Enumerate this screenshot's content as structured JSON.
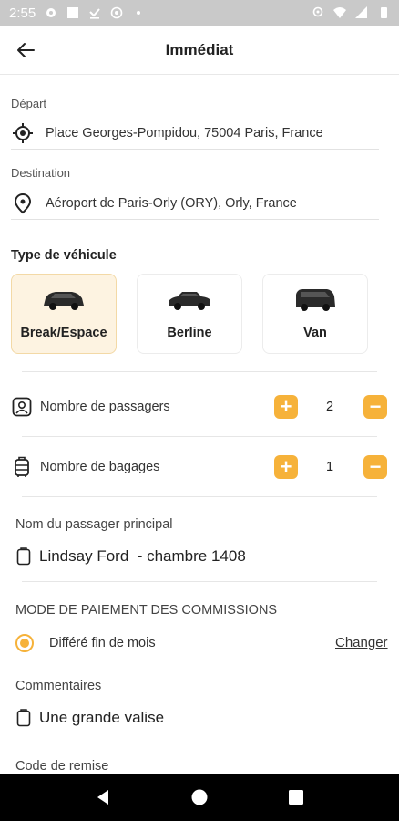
{
  "status_bar": {
    "time": "2:55"
  },
  "header": {
    "title": "Immédiat"
  },
  "departure": {
    "label": "Départ",
    "value": "Place Georges-Pompidou, 75004 Paris, France"
  },
  "destination": {
    "label": "Destination",
    "value": "Aéroport de Paris-Orly (ORY), Orly, France"
  },
  "vehicle_type": {
    "title": "Type de véhicule",
    "options": [
      {
        "label": "Break/Espace",
        "selected": true
      },
      {
        "label": "Berline",
        "selected": false
      },
      {
        "label": "Van",
        "selected": false
      }
    ]
  },
  "passengers": {
    "label": "Nombre de passagers",
    "count": "2"
  },
  "luggage": {
    "label": "Nombre de bagages",
    "count": "1"
  },
  "main_passenger": {
    "label": "Nom du passager principal",
    "value": "Lindsay Ford  - chambre 1408"
  },
  "payment": {
    "title": "MODE DE PAIEMENT DES COMMISSIONS",
    "option": "Différé fin de mois",
    "change_label": "Changer"
  },
  "comments": {
    "label": "Commentaires",
    "value": "Une grande valise"
  },
  "discount": {
    "label": "Code de remise"
  },
  "colors": {
    "accent": "#f6b23a",
    "selected_bg": "#fdf3e1"
  }
}
